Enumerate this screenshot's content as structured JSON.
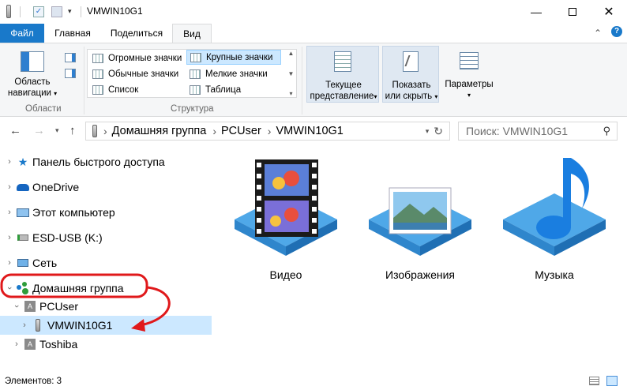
{
  "window": {
    "title": "VMWIN10G1"
  },
  "ribbon_tabs": [
    "Файл",
    "Главная",
    "Поделиться",
    "Вид"
  ],
  "ribbon": {
    "nav_area": {
      "label_line1": "Область",
      "label_line2": "навигации"
    },
    "groups": {
      "panes": "Области",
      "layout": "Структура"
    },
    "layout_options": {
      "huge_icons": "Огромные значки",
      "large_icons": "Крупные значки",
      "medium_icons": "Обычные значки",
      "small_icons": "Мелкие значки",
      "list": "Список",
      "table": "Таблица"
    },
    "current_view": {
      "line1": "Текущее",
      "line2": "представление"
    },
    "show_hide": {
      "line1": "Показать",
      "line2": "или скрыть"
    },
    "options": "Параметры"
  },
  "address": {
    "breadcrumb": [
      "Домашняя группа",
      "PCUser",
      "VMWIN10G1"
    ],
    "search_placeholder": "Поиск: VMWIN10G1"
  },
  "nav_pane": {
    "quick_access": "Панель быстрого доступа",
    "onedrive": "OneDrive",
    "this_pc": "Этот компьютер",
    "usb": "ESD-USB (K:)",
    "network": "Сеть",
    "homegroup": "Домашняя группа",
    "pcuser": "PCUser",
    "vmwin": "VMWIN10G1",
    "toshiba": "Toshiba"
  },
  "folders": [
    "Видео",
    "Изображения",
    "Музыка"
  ],
  "status": {
    "items": "Элементов: 3"
  },
  "colors": {
    "accent": "#1979ca",
    "selection": "#cce8ff",
    "annotation": "#e0191b"
  }
}
